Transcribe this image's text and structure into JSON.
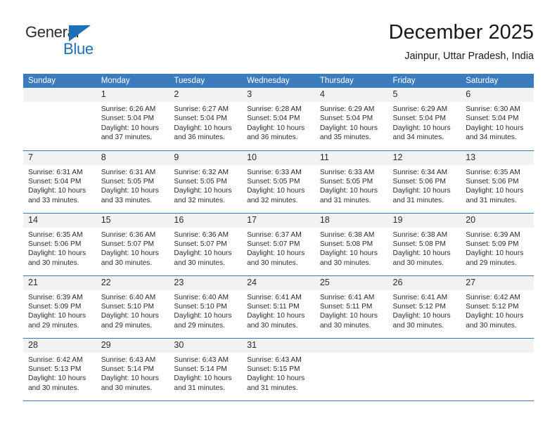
{
  "logo": {
    "word_top": "General",
    "word_bottom": "Blue",
    "triangle_color": "#1d70b8",
    "top_color": "#2b2b2b",
    "bottom_color": "#1d70b8"
  },
  "header": {
    "title": "December 2025",
    "subtitle": "Jainpur, Uttar Pradesh, India"
  },
  "theme": {
    "header_bg": "#3a7cbe",
    "header_text": "#ffffff",
    "daynum_bg": "#f2f2f2",
    "cell_bg": "#ffffff",
    "grid_line": "#3a7cbe",
    "body_text": "#2b2b2b"
  },
  "weekdays": [
    "Sunday",
    "Monday",
    "Tuesday",
    "Wednesday",
    "Thursday",
    "Friday",
    "Saturday"
  ],
  "weeks": [
    [
      {
        "day": "",
        "sunrise": "",
        "sunset": "",
        "daylight1": "",
        "daylight2": "",
        "empty": true
      },
      {
        "day": "1",
        "sunrise": "Sunrise: 6:26 AM",
        "sunset": "Sunset: 5:04 PM",
        "daylight1": "Daylight: 10 hours",
        "daylight2": "and 37 minutes."
      },
      {
        "day": "2",
        "sunrise": "Sunrise: 6:27 AM",
        "sunset": "Sunset: 5:04 PM",
        "daylight1": "Daylight: 10 hours",
        "daylight2": "and 36 minutes."
      },
      {
        "day": "3",
        "sunrise": "Sunrise: 6:28 AM",
        "sunset": "Sunset: 5:04 PM",
        "daylight1": "Daylight: 10 hours",
        "daylight2": "and 36 minutes."
      },
      {
        "day": "4",
        "sunrise": "Sunrise: 6:29 AM",
        "sunset": "Sunset: 5:04 PM",
        "daylight1": "Daylight: 10 hours",
        "daylight2": "and 35 minutes."
      },
      {
        "day": "5",
        "sunrise": "Sunrise: 6:29 AM",
        "sunset": "Sunset: 5:04 PM",
        "daylight1": "Daylight: 10 hours",
        "daylight2": "and 34 minutes."
      },
      {
        "day": "6",
        "sunrise": "Sunrise: 6:30 AM",
        "sunset": "Sunset: 5:04 PM",
        "daylight1": "Daylight: 10 hours",
        "daylight2": "and 34 minutes."
      }
    ],
    [
      {
        "day": "7",
        "sunrise": "Sunrise: 6:31 AM",
        "sunset": "Sunset: 5:04 PM",
        "daylight1": "Daylight: 10 hours",
        "daylight2": "and 33 minutes."
      },
      {
        "day": "8",
        "sunrise": "Sunrise: 6:31 AM",
        "sunset": "Sunset: 5:05 PM",
        "daylight1": "Daylight: 10 hours",
        "daylight2": "and 33 minutes."
      },
      {
        "day": "9",
        "sunrise": "Sunrise: 6:32 AM",
        "sunset": "Sunset: 5:05 PM",
        "daylight1": "Daylight: 10 hours",
        "daylight2": "and 32 minutes."
      },
      {
        "day": "10",
        "sunrise": "Sunrise: 6:33 AM",
        "sunset": "Sunset: 5:05 PM",
        "daylight1": "Daylight: 10 hours",
        "daylight2": "and 32 minutes."
      },
      {
        "day": "11",
        "sunrise": "Sunrise: 6:33 AM",
        "sunset": "Sunset: 5:05 PM",
        "daylight1": "Daylight: 10 hours",
        "daylight2": "and 31 minutes."
      },
      {
        "day": "12",
        "sunrise": "Sunrise: 6:34 AM",
        "sunset": "Sunset: 5:06 PM",
        "daylight1": "Daylight: 10 hours",
        "daylight2": "and 31 minutes."
      },
      {
        "day": "13",
        "sunrise": "Sunrise: 6:35 AM",
        "sunset": "Sunset: 5:06 PM",
        "daylight1": "Daylight: 10 hours",
        "daylight2": "and 31 minutes."
      }
    ],
    [
      {
        "day": "14",
        "sunrise": "Sunrise: 6:35 AM",
        "sunset": "Sunset: 5:06 PM",
        "daylight1": "Daylight: 10 hours",
        "daylight2": "and 30 minutes."
      },
      {
        "day": "15",
        "sunrise": "Sunrise: 6:36 AM",
        "sunset": "Sunset: 5:07 PM",
        "daylight1": "Daylight: 10 hours",
        "daylight2": "and 30 minutes."
      },
      {
        "day": "16",
        "sunrise": "Sunrise: 6:36 AM",
        "sunset": "Sunset: 5:07 PM",
        "daylight1": "Daylight: 10 hours",
        "daylight2": "and 30 minutes."
      },
      {
        "day": "17",
        "sunrise": "Sunrise: 6:37 AM",
        "sunset": "Sunset: 5:07 PM",
        "daylight1": "Daylight: 10 hours",
        "daylight2": "and 30 minutes."
      },
      {
        "day": "18",
        "sunrise": "Sunrise: 6:38 AM",
        "sunset": "Sunset: 5:08 PM",
        "daylight1": "Daylight: 10 hours",
        "daylight2": "and 30 minutes."
      },
      {
        "day": "19",
        "sunrise": "Sunrise: 6:38 AM",
        "sunset": "Sunset: 5:08 PM",
        "daylight1": "Daylight: 10 hours",
        "daylight2": "and 30 minutes."
      },
      {
        "day": "20",
        "sunrise": "Sunrise: 6:39 AM",
        "sunset": "Sunset: 5:09 PM",
        "daylight1": "Daylight: 10 hours",
        "daylight2": "and 29 minutes."
      }
    ],
    [
      {
        "day": "21",
        "sunrise": "Sunrise: 6:39 AM",
        "sunset": "Sunset: 5:09 PM",
        "daylight1": "Daylight: 10 hours",
        "daylight2": "and 29 minutes."
      },
      {
        "day": "22",
        "sunrise": "Sunrise: 6:40 AM",
        "sunset": "Sunset: 5:10 PM",
        "daylight1": "Daylight: 10 hours",
        "daylight2": "and 29 minutes."
      },
      {
        "day": "23",
        "sunrise": "Sunrise: 6:40 AM",
        "sunset": "Sunset: 5:10 PM",
        "daylight1": "Daylight: 10 hours",
        "daylight2": "and 29 minutes."
      },
      {
        "day": "24",
        "sunrise": "Sunrise: 6:41 AM",
        "sunset": "Sunset: 5:11 PM",
        "daylight1": "Daylight: 10 hours",
        "daylight2": "and 30 minutes."
      },
      {
        "day": "25",
        "sunrise": "Sunrise: 6:41 AM",
        "sunset": "Sunset: 5:11 PM",
        "daylight1": "Daylight: 10 hours",
        "daylight2": "and 30 minutes."
      },
      {
        "day": "26",
        "sunrise": "Sunrise: 6:41 AM",
        "sunset": "Sunset: 5:12 PM",
        "daylight1": "Daylight: 10 hours",
        "daylight2": "and 30 minutes."
      },
      {
        "day": "27",
        "sunrise": "Sunrise: 6:42 AM",
        "sunset": "Sunset: 5:12 PM",
        "daylight1": "Daylight: 10 hours",
        "daylight2": "and 30 minutes."
      }
    ],
    [
      {
        "day": "28",
        "sunrise": "Sunrise: 6:42 AM",
        "sunset": "Sunset: 5:13 PM",
        "daylight1": "Daylight: 10 hours",
        "daylight2": "and 30 minutes."
      },
      {
        "day": "29",
        "sunrise": "Sunrise: 6:43 AM",
        "sunset": "Sunset: 5:14 PM",
        "daylight1": "Daylight: 10 hours",
        "daylight2": "and 30 minutes."
      },
      {
        "day": "30",
        "sunrise": "Sunrise: 6:43 AM",
        "sunset": "Sunset: 5:14 PM",
        "daylight1": "Daylight: 10 hours",
        "daylight2": "and 31 minutes."
      },
      {
        "day": "31",
        "sunrise": "Sunrise: 6:43 AM",
        "sunset": "Sunset: 5:15 PM",
        "daylight1": "Daylight: 10 hours",
        "daylight2": "and 31 minutes."
      },
      {
        "day": "",
        "sunrise": "",
        "sunset": "",
        "daylight1": "",
        "daylight2": "",
        "empty": true
      },
      {
        "day": "",
        "sunrise": "",
        "sunset": "",
        "daylight1": "",
        "daylight2": "",
        "empty": true
      },
      {
        "day": "",
        "sunrise": "",
        "sunset": "",
        "daylight1": "",
        "daylight2": "",
        "empty": true
      }
    ]
  ]
}
